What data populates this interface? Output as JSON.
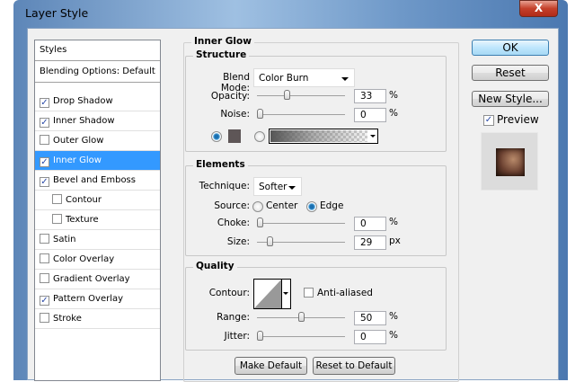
{
  "window": {
    "title": "Layer Style",
    "close": "X"
  },
  "sidebar": {
    "items": [
      {
        "label": "Styles",
        "checkbox": null,
        "selected": false,
        "indent": false
      },
      {
        "label": "Blending Options: Default",
        "checkbox": null,
        "selected": false,
        "indent": false
      },
      {
        "label": "Drop Shadow",
        "checkbox": true,
        "selected": false,
        "indent": false
      },
      {
        "label": "Inner Shadow",
        "checkbox": true,
        "selected": false,
        "indent": false
      },
      {
        "label": "Outer Glow",
        "checkbox": false,
        "selected": false,
        "indent": false
      },
      {
        "label": "Inner Glow",
        "checkbox": true,
        "selected": true,
        "indent": false
      },
      {
        "label": "Bevel and Emboss",
        "checkbox": true,
        "selected": false,
        "indent": false
      },
      {
        "label": "Contour",
        "checkbox": false,
        "selected": false,
        "indent": true
      },
      {
        "label": "Texture",
        "checkbox": false,
        "selected": false,
        "indent": true
      },
      {
        "label": "Satin",
        "checkbox": false,
        "selected": false,
        "indent": false
      },
      {
        "label": "Color Overlay",
        "checkbox": false,
        "selected": false,
        "indent": false
      },
      {
        "label": "Gradient Overlay",
        "checkbox": false,
        "selected": false,
        "indent": false
      },
      {
        "label": "Pattern Overlay",
        "checkbox": true,
        "selected": false,
        "indent": false
      },
      {
        "label": "Stroke",
        "checkbox": false,
        "selected": false,
        "indent": false
      }
    ]
  },
  "panel": {
    "title": "Inner Glow",
    "structure": {
      "title": "Structure",
      "blend_label": "Blend Mode:",
      "blend_value": "Color Burn",
      "opacity_label": "Opacity:",
      "opacity": {
        "value": "33",
        "fraction": 0.33
      },
      "pct": "%",
      "noise_label": "Noise:",
      "noise": {
        "value": "0",
        "fraction": 0
      },
      "glow_color": "#5e5657"
    },
    "elements": {
      "title": "Elements",
      "technique_label": "Technique:",
      "technique_value": "Softer",
      "source_label": "Source:",
      "center": "Center",
      "edge": "Edge",
      "choke_label": "Choke:",
      "choke": {
        "value": "0",
        "fraction": 0
      },
      "size_label": "Size:",
      "size": {
        "value": "29",
        "fraction": 0.116
      },
      "px": "px"
    },
    "quality": {
      "title": "Quality",
      "contour_label": "Contour:",
      "anti_aliased": "Anti-aliased",
      "range_label": "Range:",
      "range": {
        "value": "50",
        "fraction": 0.5
      },
      "jitter_label": "Jitter:",
      "jitter": {
        "value": "0",
        "fraction": 0
      }
    },
    "make_default": "Make Default",
    "reset_default": "Reset to Default"
  },
  "actions": {
    "ok": "OK",
    "reset": "Reset",
    "new_style": "New Style...",
    "preview": "Preview",
    "preview_checked": true
  }
}
